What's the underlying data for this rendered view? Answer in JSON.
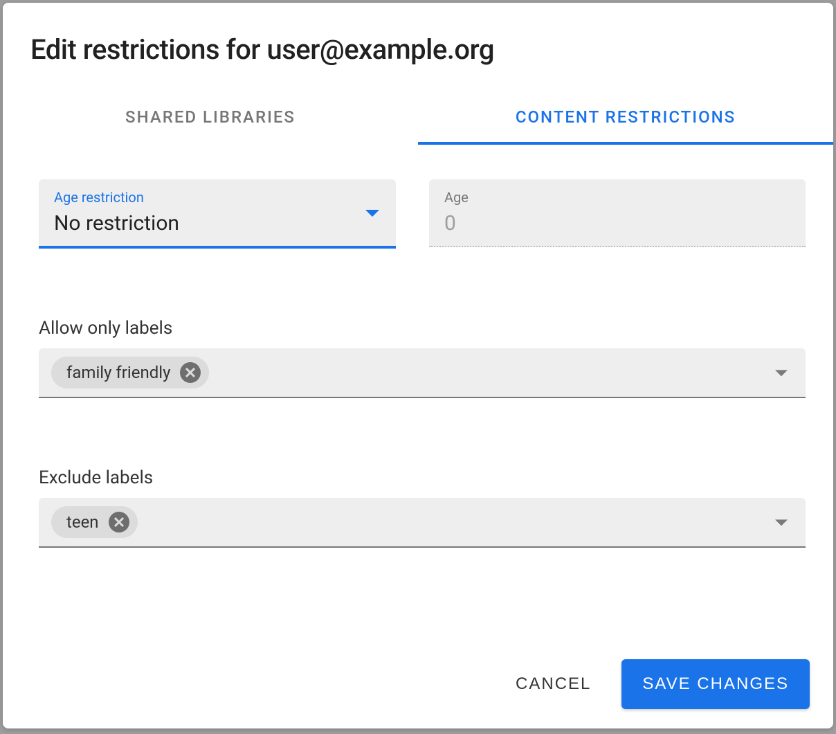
{
  "dialog": {
    "title": "Edit restrictions for user@example.org"
  },
  "tabs": {
    "shared_libraries": "Shared Libraries",
    "content_restrictions": "Content Restrictions"
  },
  "age_restriction": {
    "label": "Age restriction",
    "value": "No restriction"
  },
  "age": {
    "label": "Age",
    "placeholder": "0"
  },
  "allow_labels": {
    "title": "Allow only labels",
    "chips": [
      "family friendly"
    ]
  },
  "exclude_labels": {
    "title": "Exclude labels",
    "chips": [
      "teen"
    ]
  },
  "actions": {
    "cancel": "Cancel",
    "save": "Save Changes"
  }
}
